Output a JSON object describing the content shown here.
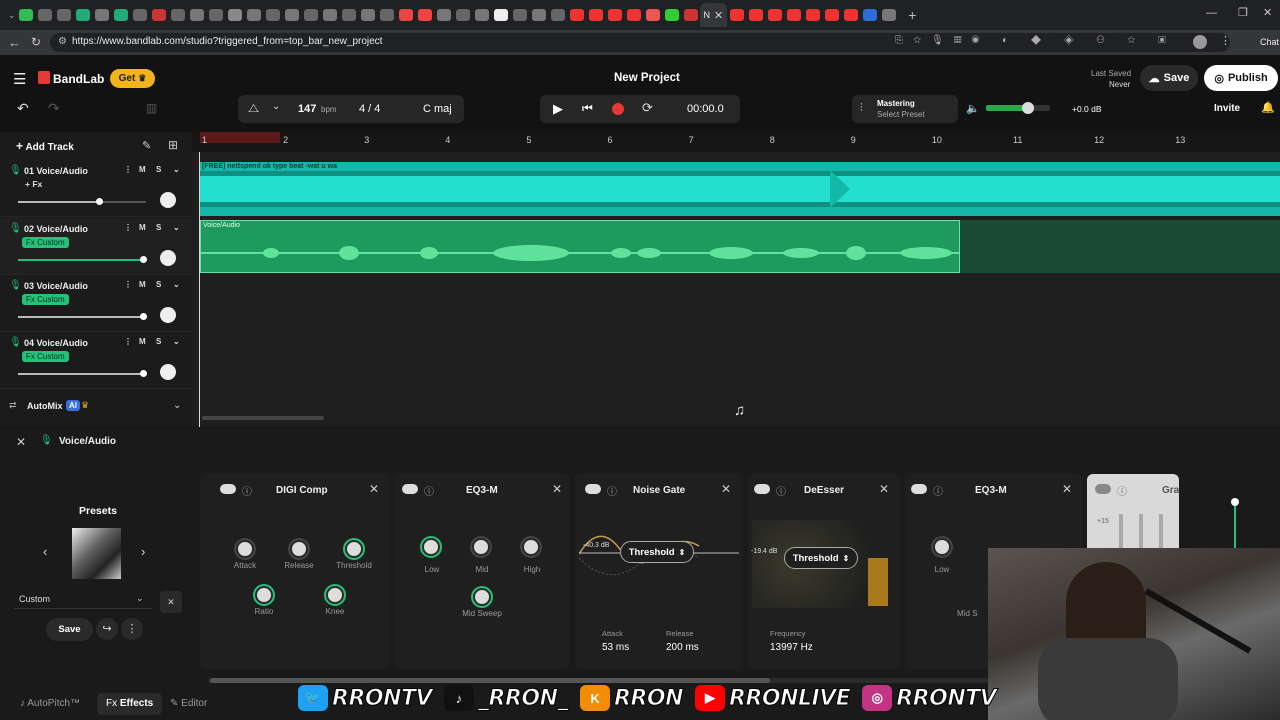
{
  "browser": {
    "url": "https://www.bandlab.com/studio?triggered_from=top_bar_new_project",
    "active_tab_label": "N",
    "chat_label": "Chat"
  },
  "app": {
    "brand": "BandLab",
    "get_label": "Get",
    "project_title": "New Project",
    "last_saved_label": "Last Saved",
    "last_saved_value": "Never",
    "save_label": "Save",
    "publish_label": "Publish",
    "invite_label": "Invite"
  },
  "transport": {
    "bpm": "147",
    "bpm_unit": "bpm",
    "time_signature": "4 / 4",
    "key": "C maj",
    "time": "00:00.0",
    "mastering_label": "Mastering",
    "mastering_preset": "Select Preset",
    "master_db": "+0.0 dB"
  },
  "tracks_panel": {
    "add_track_label": "Add Track",
    "automix_label": "AutoMix",
    "ai_badge": "AI"
  },
  "tracks": [
    {
      "name": "01  Voice/Audio",
      "tag": "+ Fx",
      "tag_style": "plain",
      "volume": 0.64
    },
    {
      "name": "02  Voice/Audio",
      "tag": "Fx Custom",
      "tag_style": "green",
      "volume": 0.97
    },
    {
      "name": "03  Voice/Audio",
      "tag": "Fx Custom",
      "tag_style": "green",
      "volume": 0.97
    },
    {
      "name": "04  Voice/Audio",
      "tag": "Fx Custom",
      "tag_style": "green",
      "volume": 0.97
    }
  ],
  "ruler": [
    "1",
    "2",
    "3",
    "4",
    "5",
    "6",
    "7",
    "8",
    "9",
    "10",
    "11",
    "12",
    "13"
  ],
  "regions": [
    {
      "label": "[FREE] nettspend  ok type beat -wat u wa"
    },
    {
      "label": "Voice/Audio"
    }
  ],
  "fx_panel": {
    "track_name": "Voice/Audio",
    "presets_label": "Presets",
    "preset_value": "Custom",
    "save_label": "Save",
    "plugins": {
      "digi_comp": {
        "title": "DIGI Comp",
        "attack": "Attack",
        "release": "Release",
        "threshold": "Threshold",
        "ratio": "Ratio",
        "knee": "Knee"
      },
      "eq3": {
        "title": "EQ3-M",
        "low": "Low",
        "mid": "Mid",
        "high": "High",
        "mid_sweep": "Mid Sweep"
      },
      "noise_gate": {
        "title": "Noise Gate",
        "db": "-40.3 dB",
        "threshold": "Threshold",
        "attack_label": "Attack",
        "attack_value": "53 ms",
        "release_label": "Release",
        "release_value": "200 ms"
      },
      "deesser": {
        "title": "DeEsser",
        "db": "-19.4 dB",
        "threshold": "Threshold",
        "frequency_label": "Frequency",
        "frequency_value": "13997 Hz"
      },
      "eq3_2": {
        "title": "EQ3-M",
        "low": "Low",
        "mid_partial": "Mid S"
      },
      "partial": {
        "title": "Gra",
        "db_scale": "+15"
      }
    }
  },
  "bottom_tabs": {
    "autopitch": "AutoPitch™",
    "effects": "Effects",
    "editor": "Editor",
    "fx_prefix": "Fx"
  },
  "overlay": {
    "socials": [
      {
        "label": "RRONTV",
        "icon": "twitter-icon"
      },
      {
        "label": "_RRON_",
        "icon": "tiktok-icon"
      },
      {
        "label": "RRON",
        "icon": "kick-icon"
      },
      {
        "label": "RRONLIVE",
        "icon": "youtube-icon"
      },
      {
        "label": "RRONTV",
        "icon": "instagram-icon"
      }
    ]
  },
  "colors": {
    "beat_region": "#1ed3c0",
    "vocal_region": "#1f9a5e",
    "fx_green": "#23c27a",
    "record_red": "#e53935",
    "get_yellow": "#f2b31b"
  }
}
